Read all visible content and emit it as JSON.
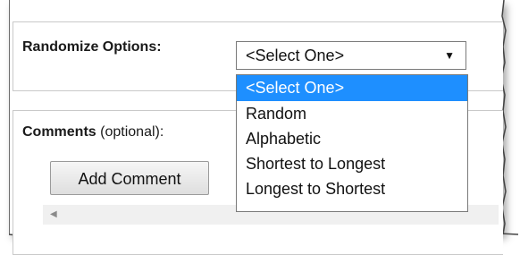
{
  "form": {
    "randomize_label": "Randomize Options:",
    "comments_label": "Comments",
    "comments_optional": "(optional):",
    "add_comment_label": "Add Comment"
  },
  "select": {
    "current_value": "<Select One>",
    "caret_icon": "caret-down-icon",
    "options": [
      "<Select One>",
      "Random",
      "Alphabetic",
      "Shortest to Longest",
      "Longest to Shortest"
    ],
    "highlighted_option": "<Select One>",
    "highlight_color": "#1e8fff"
  },
  "scrollbar": {
    "left_arrow_icon": "scroll-left-arrow-icon"
  }
}
